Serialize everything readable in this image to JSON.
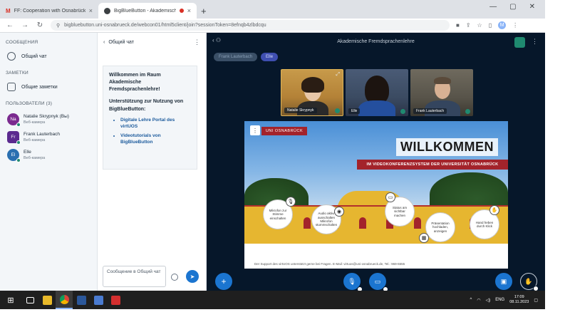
{
  "browser": {
    "tabs": [
      {
        "title": "FF: Cooperation with Osnabrück",
        "close": "×"
      },
      {
        "title": "BigBlueButton - Akademische",
        "close": "×"
      }
    ],
    "new_tab": "+",
    "window_controls": {
      "minimize": "—",
      "maximize": "▢",
      "close": "✕"
    },
    "url": "bigbluebutton.uni-osnabrueck.de/webcon01/html5client/join?sessionToken=8efnqb4zlbdcqu",
    "profile_initial": "M"
  },
  "userlist": {
    "messages_header": "СООБЩЕНИЯ",
    "public_chat": "Общий чат",
    "notes_header": "ЗАМЕТКИ",
    "shared_notes": "Общие заметки",
    "users_header": "ПОЛЬЗОВАТЕЛИ (3)",
    "users": [
      {
        "initials": "Na",
        "name": "Natalie Skrypnyk (Вы)",
        "role": "Веб-камера",
        "color": "#7b2a8f"
      },
      {
        "initials": "Fr",
        "name": "Frank Lauterbach",
        "role": "Веб-камера",
        "color": "#5b2a8f"
      },
      {
        "initials": "El",
        "name": "Elle",
        "role": "Веб-камера",
        "color": "#2a6fb0"
      }
    ]
  },
  "chat": {
    "back_label": "Общий чат",
    "welcome_title": "Willkommen im Raum Akademische Fremdsprachenlehre!",
    "support_title": "Unterstützung zur Nutzung von BigBlueButton:",
    "links": [
      "Digitale Lehre Portal des virtUOS",
      "Videotutorials von BigBlueButton"
    ],
    "input_placeholder": "Сообщение в Общий чат",
    "send_icon": "➤"
  },
  "conference": {
    "title": "Akademische Fremdsprachenlehre",
    "talkers": [
      "Frank Lauterbach",
      "Elle"
    ],
    "videos": [
      {
        "name": "Natalie Skrypnyk"
      },
      {
        "name": "Elle"
      },
      {
        "name": "Frank Lauterbach"
      }
    ],
    "slide": {
      "logo": "UNI OSNABRÜCK",
      "headline": "WILLKOMMEN",
      "banner": "IM VIDEOKONFERENZSYSTEM DER UNIVERSITÄT OSNABRÜCK",
      "bubbles": [
        "Mikrofon zur Stimme einschalten",
        "Audio aktiv/ ausschalten Mikrofon stummschalten",
        "Status am sichtbar machen",
        "Präsentation hochladen, anzeigen",
        "Hand heben durch Klick"
      ],
      "footer": "Der Support des virtUOS unterstützt gerne bei Fragen. E-Mail: virtuos@uni-osnabrueck.de, Tel.: 969-6555"
    }
  },
  "taskbar": {
    "language": "ENG",
    "time": "17:09",
    "date": "08.11.2023"
  }
}
